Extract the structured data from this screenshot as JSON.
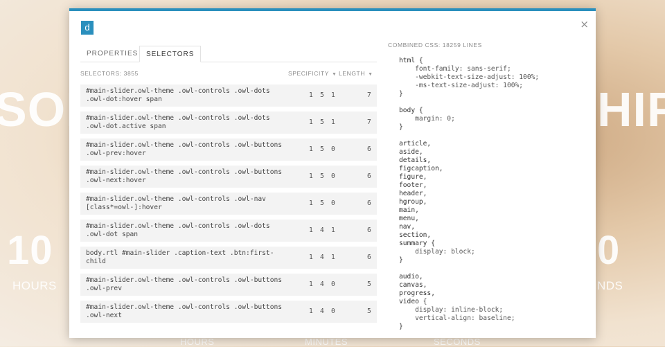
{
  "background": {
    "headline_left": "SOF",
    "headline_right": "HIP",
    "count_left": "10",
    "count_right": "0",
    "label_hours": "HOURS",
    "label_seconds_partial": "NDS",
    "bottom_labels": [
      "HOURS",
      "MINUTES",
      "SECONDS"
    ]
  },
  "modal": {
    "logo": "d",
    "close_icon": "×",
    "tabs": [
      {
        "label": "PROPERTIES",
        "active": false
      },
      {
        "label": "SELECTORS",
        "active": true
      }
    ],
    "selectors_count": "SELECTORS: 3855",
    "col_specificity": "SPECIFICITY",
    "col_length": "LENGTH",
    "rows": [
      {
        "l1": "#main-slider.owl-theme .owl-controls .owl-dots",
        "l2": ".owl-dot:hover span",
        "a": "1",
        "b": "5",
        "c": "1",
        "len": "7"
      },
      {
        "l1": "#main-slider.owl-theme .owl-controls .owl-dots",
        "l2": ".owl-dot.active span",
        "a": "1",
        "b": "5",
        "c": "1",
        "len": "7"
      },
      {
        "l1": "#main-slider.owl-theme .owl-controls .owl-buttons",
        "l2": ".owl-prev:hover",
        "a": "1",
        "b": "5",
        "c": "0",
        "len": "6"
      },
      {
        "l1": "#main-slider.owl-theme .owl-controls .owl-buttons",
        "l2": ".owl-next:hover",
        "a": "1",
        "b": "5",
        "c": "0",
        "len": "6"
      },
      {
        "l1": "#main-slider.owl-theme .owl-controls .owl-nav",
        "l2": "[class*=owl-]:hover",
        "a": "1",
        "b": "5",
        "c": "0",
        "len": "6"
      },
      {
        "l1": "#main-slider.owl-theme .owl-controls .owl-dots",
        "l2": ".owl-dot span",
        "a": "1",
        "b": "4",
        "c": "1",
        "len": "6"
      },
      {
        "l1": "body.rtl #main-slider .caption-text .btn:first-",
        "l2": "child",
        "a": "1",
        "b": "4",
        "c": "1",
        "len": "6"
      },
      {
        "l1": "#main-slider.owl-theme .owl-controls .owl-buttons",
        "l2": ".owl-prev",
        "a": "1",
        "b": "4",
        "c": "0",
        "len": "5"
      },
      {
        "l1": "#main-slider.owl-theme .owl-controls .owl-buttons",
        "l2": ".owl-next",
        "a": "1",
        "b": "4",
        "c": "0",
        "len": "5"
      }
    ],
    "combined_css": "COMBINED CSS: 18259 LINES",
    "css_lines": [
      "html {",
      "    font-family: sans-serif;",
      "    -webkit-text-size-adjust: 100%;",
      "    -ms-text-size-adjust: 100%;",
      "}",
      "",
      "body {",
      "    margin: 0;",
      "}",
      "",
      "article,",
      "aside,",
      "details,",
      "figcaption,",
      "figure,",
      "footer,",
      "header,",
      "hgroup,",
      "main,",
      "menu,",
      "nav,",
      "section,",
      "summary {",
      "    display: block;",
      "}",
      "",
      "audio,",
      "canvas,",
      "progress,",
      "video {",
      "    display: inline-block;",
      "    vertical-align: baseline;",
      "}"
    ]
  }
}
